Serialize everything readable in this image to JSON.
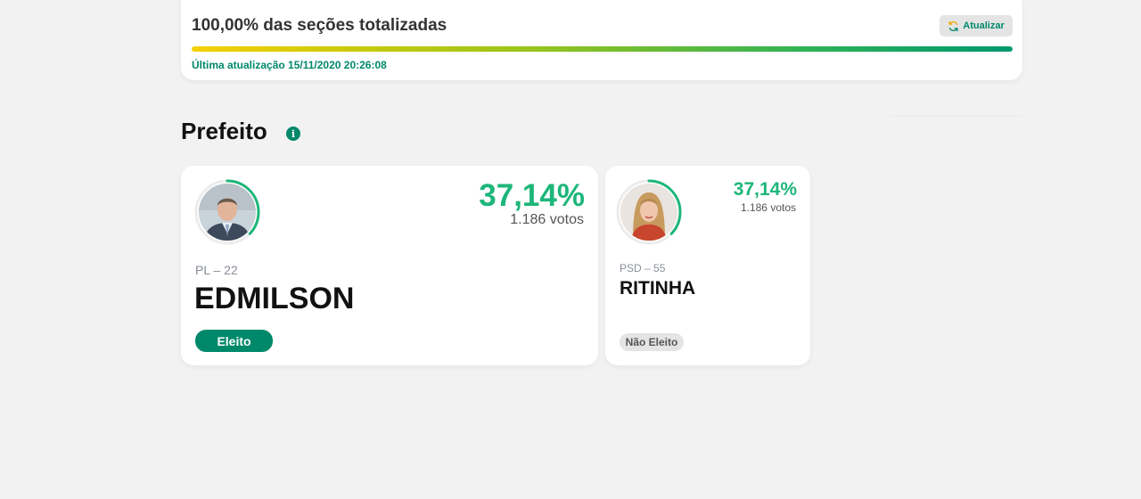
{
  "status": {
    "title": "100,00% das seções totalizadas",
    "progress_fraction": 1.0,
    "refresh_label": "Atualizar",
    "refresh_icon": "refresh-icon",
    "last_update": "Última atualização 15/11/2020 20:26:08"
  },
  "section": {
    "title": "Prefeito",
    "info_icon": "info-icon"
  },
  "candidates": [
    {
      "percent": "37,14%",
      "votes": "1.186 votos",
      "party": "PL – 22",
      "name": "EDMILSON",
      "status": "Eleito",
      "ring_fraction": 0.3714
    },
    {
      "percent": "37,14%",
      "votes": "1.186 votos",
      "party": "PSD – 55",
      "name": "RITINHA",
      "status": "Não Eleito",
      "ring_fraction": 0.3714
    }
  ],
  "colors": {
    "accent": "#00886a",
    "percent": "#1db67a",
    "elected_bg": "#00886a",
    "not_elected_bg": "#e4e4e4"
  }
}
